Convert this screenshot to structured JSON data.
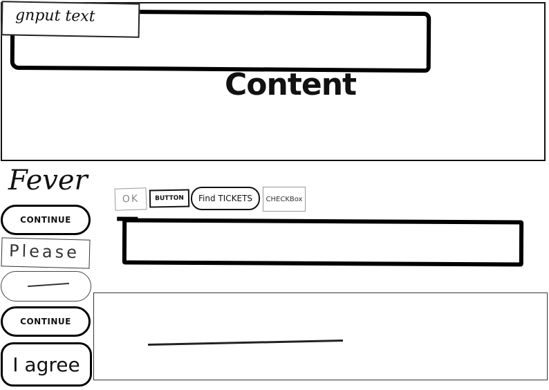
{
  "top_panel": {
    "input_label": "gnput text",
    "content_label": "Content"
  },
  "sidebar": {
    "title": "Fever",
    "continue_1": "CONTINUE",
    "please": "Please",
    "continue_2": "CONTINUE",
    "agree": "I agree"
  },
  "toolbar": {
    "ok": "OK",
    "button": "BUTTON",
    "find_tickets": "Find TICKETS",
    "checkbox": "CHECKBox"
  }
}
